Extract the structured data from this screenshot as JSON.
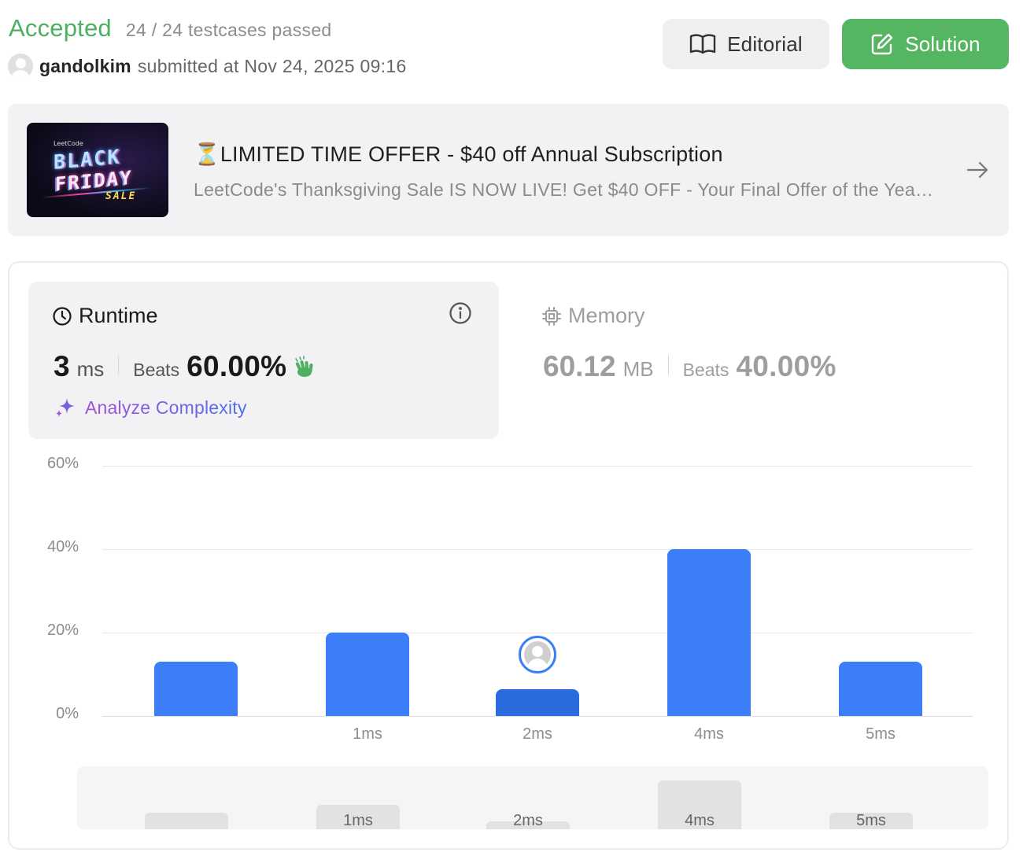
{
  "status": {
    "verdict": "Accepted",
    "testcases": "24 / 24 testcases passed",
    "username": "gandolkim",
    "submitted": "submitted at Nov 24, 2025 09:16"
  },
  "buttons": {
    "editorial": "Editorial",
    "solution": "Solution"
  },
  "promo": {
    "image_text": {
      "brand": "LeetCode",
      "line1": "BLACK",
      "line2": "FRIDAY",
      "line3": "SALE"
    },
    "title_prefix": "⏳",
    "title": "LIMITED TIME OFFER - $40 off Annual Subscription",
    "description": "LeetCode's Thanksgiving Sale IS NOW LIVE! Get $40 OFF - Your Final Offer of the Year - Don't Miss Out!"
  },
  "runtime": {
    "label": "Runtime",
    "value": "3",
    "unit": "ms",
    "beats_label": "Beats",
    "beats": "60.00%",
    "analyze": "Analyze Complexity"
  },
  "memory": {
    "label": "Memory",
    "value": "60.12",
    "unit": "MB",
    "beats_label": "Beats",
    "beats": "40.00%"
  },
  "icons": {
    "runtime": "clock-icon",
    "memory": "chip-icon",
    "info": "info-icon",
    "clap": "clap-icon",
    "analyze": "sparkle-icon",
    "editorial": "book-icon",
    "solution": "edit-icon",
    "promo": "arrow-right-icon"
  },
  "colors": {
    "accepted": "#4caf61",
    "solution_button": "#55b661",
    "bar": "#3b7ef7",
    "bar_active": "#2a6be0"
  },
  "chart_data": {
    "type": "bar",
    "categories": [
      "",
      "1ms",
      "2ms",
      "4ms",
      "5ms"
    ],
    "values": [
      13,
      20,
      6.5,
      40,
      13
    ],
    "yticks": [
      "0%",
      "20%",
      "40%",
      "60%"
    ],
    "ylim": [
      0,
      60
    ],
    "highlight_index": 2,
    "overview_values": [
      4,
      6,
      2,
      12,
      4
    ]
  }
}
